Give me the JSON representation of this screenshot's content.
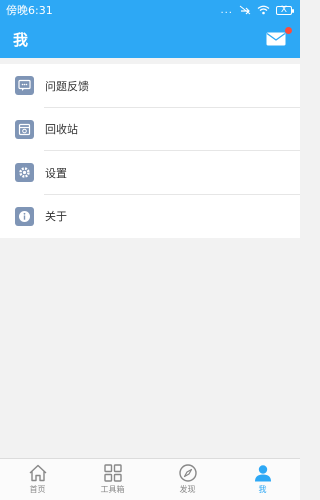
{
  "status_bar": {
    "time": "傍晚6:31",
    "dots": "...",
    "battery_mark": "X"
  },
  "header": {
    "title": "我"
  },
  "menu": [
    {
      "label": "问题反馈",
      "icon": "feedback-icon"
    },
    {
      "label": "回收站",
      "icon": "recycle-bin-icon"
    },
    {
      "label": "设置",
      "icon": "gear-icon"
    },
    {
      "label": "关于",
      "icon": "info-icon"
    }
  ],
  "tabs": [
    {
      "label": "首页",
      "icon": "home-icon",
      "active": false
    },
    {
      "label": "工具箱",
      "icon": "toolbox-icon",
      "active": false
    },
    {
      "label": "发现",
      "icon": "compass-icon",
      "active": false
    },
    {
      "label": "我",
      "icon": "person-icon",
      "active": true
    }
  ],
  "colors": {
    "primary": "#2da8f5",
    "icon_bg": "#7f95b6",
    "badge": "#ff4b3a",
    "tab_inactive": "#888888"
  }
}
